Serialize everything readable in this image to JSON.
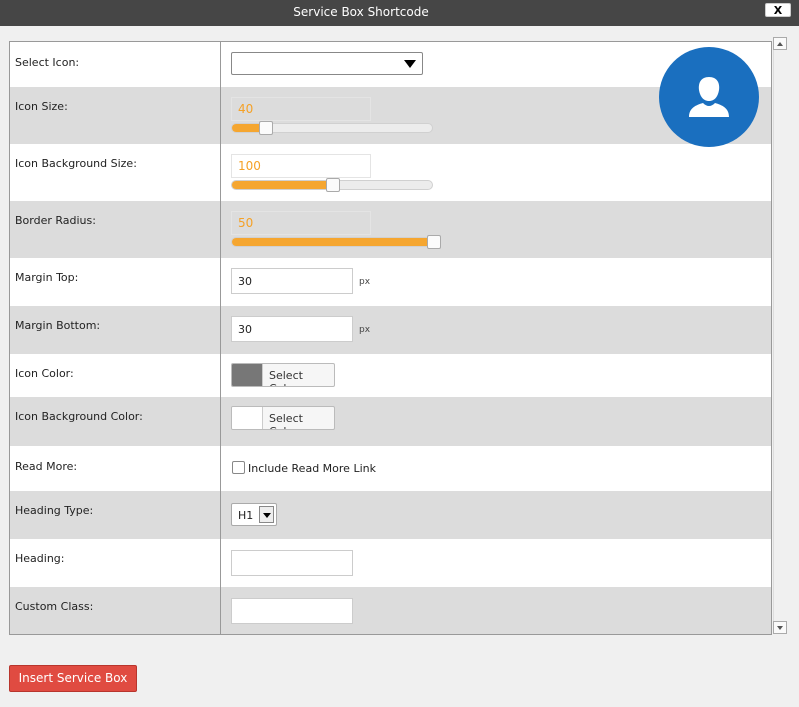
{
  "window": {
    "title": "Service Box Shortcode",
    "close_label": "X"
  },
  "colors": {
    "accent": "#f5a630",
    "preview": "#1a6fbf",
    "icon_color": "#777777",
    "icon_bg_color": "#ffffff",
    "insert_button": "#e04b41"
  },
  "preview": {
    "icon": "user-icon"
  },
  "fields": {
    "select_icon": {
      "label": "Select Icon:",
      "value": ""
    },
    "icon_size": {
      "label": "Icon Size:",
      "value": "40",
      "slider_fraction": 0.17
    },
    "icon_bg_size": {
      "label": "Icon Background Size:",
      "value": "100",
      "slider_fraction": 0.5
    },
    "border_radius": {
      "label": "Border Radius:",
      "value": "50",
      "slider_fraction": 1.0
    },
    "margin_top": {
      "label": "Margin Top:",
      "value": "30",
      "unit": "px"
    },
    "margin_bottom": {
      "label": "Margin Bottom:",
      "value": "30",
      "unit": "px"
    },
    "icon_color": {
      "label": "Icon Color:",
      "button": "Select Color"
    },
    "icon_bg_color": {
      "label": "Icon Background Color:",
      "button": "Select Color"
    },
    "read_more": {
      "label": "Read More:",
      "checkbox_label": "Include Read More Link",
      "checked": false
    },
    "heading_type": {
      "label": "Heading Type:",
      "value": "H1"
    },
    "heading": {
      "label": "Heading:",
      "value": ""
    },
    "custom_class": {
      "label": "Custom Class:",
      "value": ""
    }
  },
  "actions": {
    "insert_label": "Insert Service Box"
  }
}
